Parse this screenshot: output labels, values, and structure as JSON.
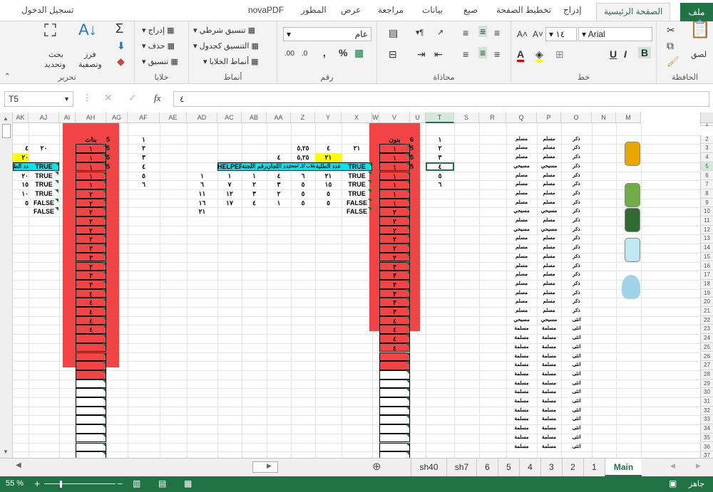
{
  "tabs": {
    "file": "ملف",
    "home": "الصفحة الرئيسية",
    "insert": "إدراج",
    "layout": "تخطيط الصفحة",
    "formulas": "صيغ",
    "data": "بيانات",
    "review": "مراجعة",
    "view": "عرض",
    "developer": "المطور",
    "nova": "novaPDF",
    "signin": "تسجيل الدخول"
  },
  "ribbon": {
    "clipboard_label": "الحافظة",
    "paste": "لصق",
    "font_label": "خط",
    "font_name": "Arial",
    "font_size": "١٤",
    "bold": "B",
    "italic": "I",
    "underline": "U",
    "align_label": "محاذاة",
    "number_label": "رقم",
    "number_format": "عام",
    "percent": "%",
    "styles_label": "أنماط",
    "cond_format": "تنسيق شرطي",
    "format_table": "التنسيق كجدول",
    "cell_styles": "أنماط الخلايا",
    "cells_label": "خلايا",
    "insert": "إدراج",
    "delete": "حذف",
    "format": "تنسيق",
    "edit_label": "تحرير",
    "sort": "فرز",
    "sort2": "وتصفية",
    "find": "بحث",
    "find2": "وتحديد"
  },
  "formula_bar": {
    "name_box": "T5",
    "fx": "fx",
    "value": "٤"
  },
  "grid": {
    "columns": [
      "AK",
      "AJ",
      "AI",
      "AH",
      "AG",
      "AF",
      "AE",
      "AD",
      "AC",
      "AB",
      "AA",
      "Z",
      "Y",
      "X",
      "W",
      "V",
      "U",
      "T",
      "S",
      "R",
      "Q",
      "P",
      "O",
      "N",
      "M"
    ],
    "rows": [
      "1",
      "2",
      "3",
      "4",
      "5",
      "6",
      "7",
      "8",
      "9",
      "10",
      "11",
      "12",
      "13",
      "14",
      "15",
      "16",
      "17",
      "18",
      "19",
      "20",
      "21",
      "22",
      "23",
      "24",
      "25",
      "26",
      "27",
      "28",
      "29",
      "30",
      "31",
      "32",
      "33",
      "34",
      "35",
      "36",
      "37"
    ],
    "headers": {
      "ah": "بنات",
      "v": "بنون",
      "helper": "HELPER",
      "committee_no": "رقم اللجنة",
      "committees": "عدد اللجان",
      "per_committee": "عدد طلاب كل لجنة",
      "students": "عدد الطلبة",
      "aj_top": "عدد الط"
    },
    "ah_values": [
      "١",
      "١",
      "١",
      "١",
      "١",
      "٢",
      "٢",
      "٢",
      "٢",
      "٢",
      "٢",
      "٣",
      "٣",
      "٣",
      "٣",
      "٣",
      "٤",
      "٤",
      "٤",
      "٤",
      "٤"
    ],
    "v_values": [
      "١",
      "١",
      "١",
      "١",
      "١",
      "١",
      "١",
      "٢",
      "٢",
      "٢",
      "٢",
      "٢",
      "٢",
      "٣",
      "٣",
      "٣",
      "٣",
      "٣",
      "٣",
      "٤",
      "٤",
      "٤",
      "٤"
    ],
    "ag": [
      "5",
      "5",
      "5",
      "5"
    ],
    "af": [
      "١",
      "٢",
      "٣",
      "٤",
      "٥",
      "٦"
    ],
    "u": [
      "6",
      "5",
      "5",
      "5"
    ],
    "t": [
      "١",
      "٢",
      "٣",
      "٤",
      "٥",
      "٦"
    ],
    "y": [
      "٤",
      "٢١",
      "",
      "٢١",
      "١٥",
      "٥",
      "٥"
    ],
    "z": [
      "٥,٢٥",
      "٥,٢٥",
      "",
      "٦",
      "٥",
      "٥",
      "٥"
    ],
    "aa": [
      "",
      "٤",
      "",
      "٤",
      "٣",
      "٢",
      "١"
    ],
    "ab": [
      "",
      "",
      "",
      "١",
      "٢",
      "٣",
      "٤"
    ],
    "ac": [
      "",
      "",
      "",
      "١",
      "٧",
      "١٢",
      "١٧"
    ],
    "ad": [
      "",
      "",
      "",
      "١",
      "٦",
      "١١",
      "١٦",
      "٢١"
    ],
    "x": [
      "٢١",
      "",
      "TRUE",
      "TRUE",
      "TRUE",
      "TRUE",
      "FALSE",
      "FALSE"
    ],
    "aj": [
      "٢٠",
      "",
      "TRUE",
      "TRUE",
      "TRUE",
      "TRUE",
      "FALSE",
      "FALSE"
    ],
    "ak": [
      "٤",
      "٢٠",
      "٢٠",
      "١٥",
      "١٠",
      "٥"
    ],
    "o_values": [
      "ذكر",
      "ذكر",
      "ذكر",
      "ذكر",
      "ذكر",
      "ذكر",
      "ذكر",
      "ذكر",
      "ذكر",
      "ذكر",
      "ذكر",
      "ذكر",
      "ذكر",
      "ذكر",
      "ذكر",
      "ذكر",
      "ذكر",
      "ذكر",
      "ذكر",
      "ذكر",
      "انثى",
      "انثى",
      "انثى",
      "انثى",
      "انثى",
      "انثى",
      "انثى",
      "انثى",
      "انثى",
      "انثى",
      "انثى",
      "انثى",
      "انثى",
      "انثى",
      "انثى"
    ],
    "p_values": [
      "مسلم",
      "مسلم",
      "مسلم",
      "مسيحي",
      "مسلم",
      "مسلم",
      "مسلم",
      "مسلم",
      "مسيحي",
      "مسلم",
      "مسيحي",
      "مسلم",
      "مسلم",
      "مسلم",
      "مسلم",
      "مسلم",
      "مسلم",
      "مسلم",
      "مسلم",
      "مسلم",
      "مسيحي",
      "مسلمة",
      "مسلمة",
      "مسلمة",
      "مسلمة",
      "مسلمة",
      "مسلمة",
      "مسلمة",
      "مسلمة",
      "مسلمة",
      "مسلمة",
      "مسلمة",
      "مسلمة",
      "مسلمة",
      "مسلمة"
    ]
  },
  "sheets": [
    "Main",
    "1",
    "2",
    "3",
    "4",
    "5",
    "6",
    "sh7",
    "sh40"
  ],
  "status": {
    "ready": "جاهز",
    "zoom": "55 %"
  },
  "colors": {
    "accent": "#217346",
    "red": "#f24444",
    "cyan": "#00e5ee",
    "yellow": "#ffff00"
  }
}
